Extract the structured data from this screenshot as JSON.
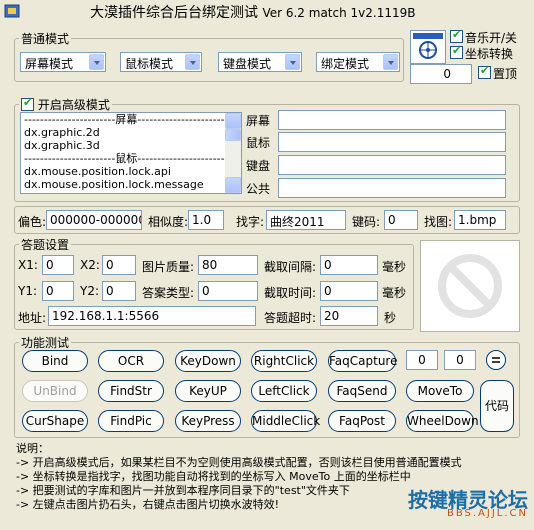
{
  "window": {
    "title": "大漠插件综合后台绑定测试",
    "version": "Ver 6.2 match 1v2.1119B"
  },
  "normal_mode": {
    "legend": "普通模式",
    "selects": [
      "屏幕模式",
      "鼠标模式",
      "键盘模式",
      "绑定模式"
    ]
  },
  "top_right": {
    "music_label": "音乐开/关",
    "music_checked": true,
    "coord_label": "坐标转换",
    "coord_checked": true,
    "number_value": "0",
    "topmost_label": "置顶",
    "topmost_checked": true
  },
  "advanced_mode": {
    "legend": "开启高级模式",
    "checked": true,
    "list_items": [
      "-----------------------屏幕-----------------------",
      "dx.graphic.2d",
      "dx.graphic.3d",
      "-----------------------鼠标-----------------------",
      "dx.mouse.position.lock.api",
      "dx.mouse.position.lock.message"
    ],
    "fields": [
      {
        "label": "屏幕",
        "value": ""
      },
      {
        "label": "鼠标",
        "value": ""
      },
      {
        "label": "键盘",
        "value": ""
      },
      {
        "label": "公共",
        "value": ""
      }
    ]
  },
  "color_row": {
    "color_label": "偏色:",
    "color_value": "000000-000000",
    "sim_label": "相似度:",
    "sim_value": "1.0",
    "findword_label": "找字:",
    "findword_value": "曲终2011",
    "key_label": "键码:",
    "key_value": "0",
    "findpic_label": "找图:",
    "findpic_value": "1.bmp"
  },
  "answer_settings": {
    "legend": "答题设置",
    "x1_label": "X1:",
    "x1_value": "0",
    "x2_label": "X2:",
    "x2_value": "0",
    "quality_label": "图片质量:",
    "quality_value": "80",
    "interval_label": "截取间隔:",
    "interval_value": "0",
    "interval_unit": "毫秒",
    "y1_label": "Y1:",
    "y1_value": "0",
    "y2_label": "Y2:",
    "y2_value": "0",
    "answer_type_label": "答案类型:",
    "answer_type_value": "0",
    "capture_time_label": "截取时间:",
    "capture_time_value": "0",
    "capture_time_unit": "毫秒",
    "address_label": "地址:",
    "address_value": "192.168.1.1:5566",
    "timeout_label": "答题超时:",
    "timeout_value": "20",
    "timeout_unit": "秒"
  },
  "function_test": {
    "legend": "功能测试",
    "row1": [
      "Bind",
      "OCR",
      "KeyDown",
      "RightClick",
      "FaqCapture"
    ],
    "row2": [
      "UnBind",
      "FindStr",
      "KeyUP",
      "LeftClick",
      "FaqSend",
      "MoveTo"
    ],
    "row3": [
      "CurShape",
      "FindPic",
      "KeyPress",
      "MiddleClick",
      "FaqPost",
      "WheelDown"
    ],
    "small_inputs": [
      "0",
      "0"
    ],
    "code_button": "代码",
    "unbind_disabled": true
  },
  "notes": {
    "title": "说明：",
    "lines": [
      "-> 开启高级模式后，如果某栏目不为空则使用高级模式配置，否则该栏目使用普通配置模式",
      "-> 坐标转换是指找字，找图功能自动将找到的坐标写入 MoveTo 上面的坐标栏中",
      "-> 把要测试的字库和图片一并放到本程序同目录下的\"test\"文件夹下",
      "-> 左键点击图片扔石头，右键点击图片切换水波特效!"
    ]
  },
  "watermark": {
    "text": "按键精灵论坛",
    "sub": "BBS.AJJL.CN"
  }
}
